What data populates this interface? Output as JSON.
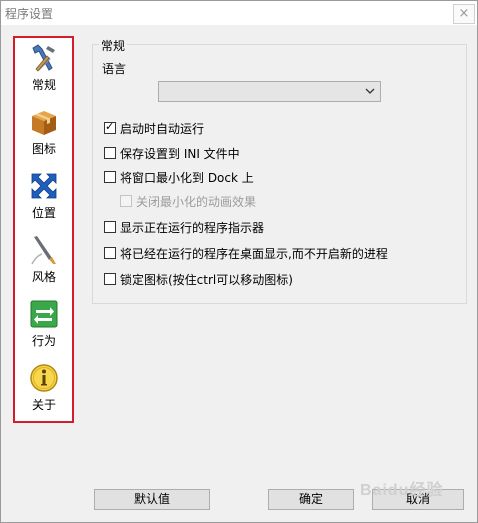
{
  "window": {
    "title": "程序设置",
    "close_glyph": "×"
  },
  "sidebar": {
    "items": [
      {
        "label": "常规",
        "icon": "tools-icon"
      },
      {
        "label": "图标",
        "icon": "box-icon"
      },
      {
        "label": "位置",
        "icon": "arrows-icon"
      },
      {
        "label": "风格",
        "icon": "brush-icon"
      },
      {
        "label": "行为",
        "icon": "switch-arrows-icon"
      },
      {
        "label": "关于",
        "icon": "info-icon"
      }
    ],
    "highlight_color": "#d51c2a"
  },
  "general": {
    "group_title": "常规",
    "language_label": "语言",
    "language_value": "",
    "options": [
      {
        "label": "启动时自动运行",
        "checked": true,
        "disabled": false
      },
      {
        "label": "保存设置到 INI 文件中",
        "checked": false,
        "disabled": false
      },
      {
        "label": "将窗口最小化到 Dock 上",
        "checked": false,
        "disabled": false
      },
      {
        "label": "关闭最小化的动画效果",
        "checked": false,
        "disabled": true
      },
      {
        "label": "显示正在运行的程序指示器",
        "checked": false,
        "disabled": false
      },
      {
        "label": "将已经在运行的程序在桌面显示,而不开启新的进程",
        "checked": false,
        "disabled": false
      },
      {
        "label": "锁定图标(按住ctrl可以移动图标)",
        "checked": false,
        "disabled": false
      }
    ]
  },
  "buttons": {
    "default": "默认值",
    "ok": "确定",
    "cancel": "取消"
  },
  "watermark": "Baidu经验"
}
